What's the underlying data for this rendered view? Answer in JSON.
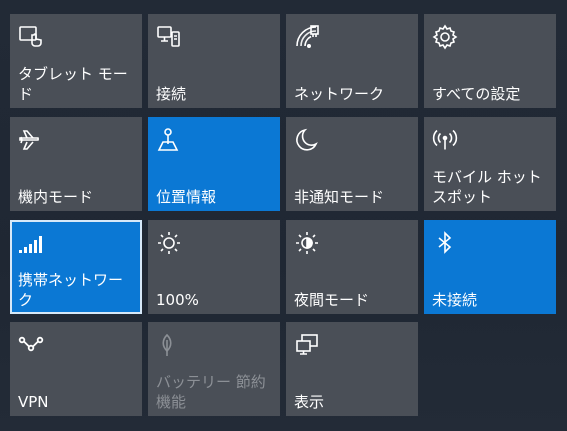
{
  "tiles": [
    {
      "label": "タブレット モード",
      "state": "off",
      "icon": "tablet-mode-icon"
    },
    {
      "label": "接続",
      "state": "off",
      "icon": "connect-icon"
    },
    {
      "label": "ネットワーク",
      "state": "off",
      "icon": "network-icon"
    },
    {
      "label": "すべての設定",
      "state": "off",
      "icon": "gear-icon"
    },
    {
      "label": "機内モード",
      "state": "off",
      "icon": "airplane-icon"
    },
    {
      "label": "位置情報",
      "state": "on",
      "icon": "location-icon"
    },
    {
      "label": "非通知モード",
      "state": "off",
      "icon": "moon-icon"
    },
    {
      "label": "モバイル ホットスポット",
      "state": "off",
      "icon": "hotspot-icon"
    },
    {
      "label": "携帯ネットワーク",
      "state": "on",
      "icon": "cellular-signal-icon"
    },
    {
      "label": "100%",
      "state": "off",
      "icon": "brightness-icon"
    },
    {
      "label": "夜間モード",
      "state": "off",
      "icon": "night-light-icon"
    },
    {
      "label": "未接続",
      "state": "on",
      "icon": "bluetooth-icon"
    },
    {
      "label": "VPN",
      "state": "off",
      "icon": "vpn-icon"
    },
    {
      "label": "バッテリー 節約機能",
      "state": "disabled",
      "icon": "battery-saver-icon"
    },
    {
      "label": "表示",
      "state": "off",
      "icon": "project-icon"
    }
  ],
  "colors": {
    "tile_off": "#4a4f57",
    "tile_on": "#0b78d4",
    "background": "#1f2733"
  }
}
